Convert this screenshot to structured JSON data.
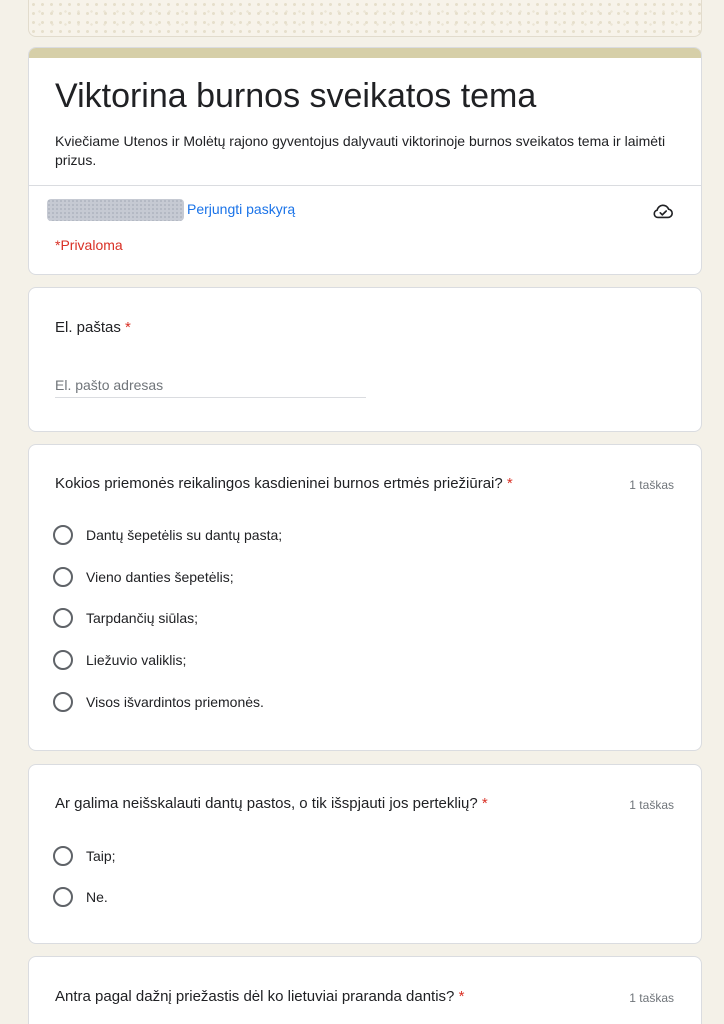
{
  "form": {
    "title": "Viktorina burnos sveikatos tema",
    "description": "Kviečiame Utenos ir Molėtų rajono gyventojus dalyvauti viktorinoje burnos sveikatos tema ir laimėti prizus.",
    "switch_account": "Perjungti paskyrą",
    "required_note": "*Privaloma",
    "accent_color": "#d6cfa8",
    "link_color": "#1a73e8",
    "required_color": "#d93025",
    "icons": {
      "cloud": "cloud-saved-icon"
    }
  },
  "email": {
    "label": "El. paštas",
    "required_mark": " *",
    "placeholder": "El. pašto adresas"
  },
  "questions": [
    {
      "title": "Kokios priemonės reikalingos kasdieninei burnos ertmės priežiūrai?",
      "required_mark": " *",
      "points": "1 taškas",
      "options": [
        "Dantų šepetėlis su dantų pasta;",
        "Vieno danties šepetėlis;",
        "Tarpdančių siūlas;",
        "Liežuvio valiklis;",
        "Visos išvardintos priemonės."
      ]
    },
    {
      "title": "Ar galima neišskalauti dantų pastos, o tik išspjauti jos perteklių?",
      "required_mark": " *",
      "points": "1 taškas",
      "options": [
        "Taip;",
        "Ne."
      ]
    },
    {
      "title": "Antra pagal dažnį priežastis dėl ko lietuviai praranda dantis?",
      "required_mark": " *",
      "points": "1 taškas",
      "options": []
    }
  ]
}
